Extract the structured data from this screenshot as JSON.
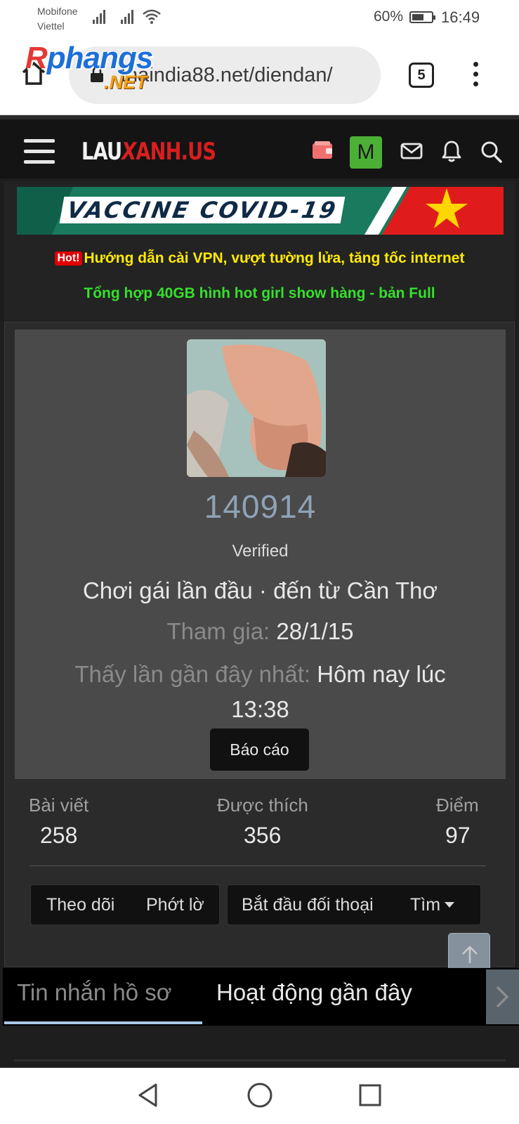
{
  "status_bar": {
    "carrier_1": "Mobifone",
    "carrier_2": "Viettel",
    "battery": "60%",
    "time": "16:49"
  },
  "browser": {
    "url_visible": "thaindia88.net/diendan/",
    "tab_count": "5",
    "icons": [
      "home-icon",
      "lock-icon",
      "tabs-icon",
      "menu-icon"
    ]
  },
  "watermark": {
    "main_prefix": "R",
    "main": "phangs",
    "sub": ".NET"
  },
  "site_header": {
    "logo_part1": "LAU",
    "logo_part2": "X",
    "logo_part3": "ANH.US",
    "avatar_letter": "M",
    "icons": [
      "menu-icon",
      "wallet-icon",
      "mail-icon",
      "bell-icon",
      "search-icon"
    ],
    "colors": {
      "wallet": "#f06f6f",
      "avatar": "#4caf36",
      "logo_accent": "#d81e1e"
    }
  },
  "banners": {
    "covid": "VACCINE COVID-19",
    "hot_badge": "Hot!",
    "promo_1": "Hướng dẫn cài VPN, vượt tường lửa, tăng tốc internet",
    "promo_2": "Tổng hợp 40GB hình hot girl show hàng - bản Full",
    "colors": {
      "promo_1": "#ffea00",
      "promo_2": "#35e02b"
    }
  },
  "profile": {
    "username": "140914",
    "role": "Verified",
    "tagline": "Chơi gái lần đầu · đến từ Cần Thơ",
    "joined_label": "Tham gia:",
    "joined_value": "28/1/15",
    "last_seen_label": "Thấy lần gần đây nhất:",
    "last_seen_value": "Hôm nay lúc 13:38",
    "report_button": "Báo cáo",
    "username_color": "#8fa3b7"
  },
  "stats": {
    "posts_label": "Bài viết",
    "posts_value": "258",
    "likes_label": "Được thích",
    "likes_value": "356",
    "points_label": "Điểm",
    "points_value": "97"
  },
  "actions": {
    "follow": "Theo dõi",
    "ignore": "Phớt lờ",
    "start_conversation": "Bắt đầu đối thoại",
    "find": "Tìm"
  },
  "tabs": {
    "items": [
      "Tin nhắn hồ sơ",
      "Hoạt động gần đây"
    ],
    "active_index": 0
  },
  "scroll_controls": [
    "arrow-up-icon",
    "arrow-down-icon"
  ],
  "android_nav": [
    "back-icon",
    "home-circle-icon",
    "recents-icon"
  ]
}
